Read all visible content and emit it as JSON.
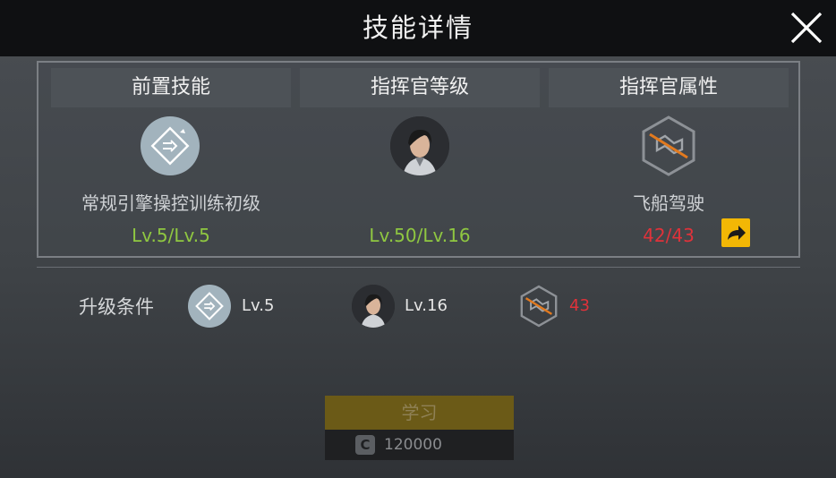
{
  "header": {
    "title": "技能详情"
  },
  "columns": [
    {
      "header": "前置技能",
      "name": "常规引擎操控训练初级",
      "level": "Lv.5/Lv.5"
    },
    {
      "header": "指挥官等级",
      "level": "Lv.50/Lv.16"
    },
    {
      "header": "指挥官属性",
      "name": "飞船驾驶",
      "level": "42/43"
    }
  ],
  "conditions": {
    "label": "升级条件",
    "skill_level": "Lv.5",
    "commander_level": "Lv.16",
    "attribute_value": "43"
  },
  "footer": {
    "learn_label": "学习",
    "cost": "120000",
    "currency_symbol": "C"
  },
  "colors": {
    "green": "#8fc741",
    "red": "#e0323a",
    "accent": "#f2b705"
  },
  "icons": [
    "close-icon",
    "engine-skill-icon",
    "commander-avatar",
    "piloting-attribute-icon",
    "jump-arrow-icon",
    "coin-icon"
  ]
}
